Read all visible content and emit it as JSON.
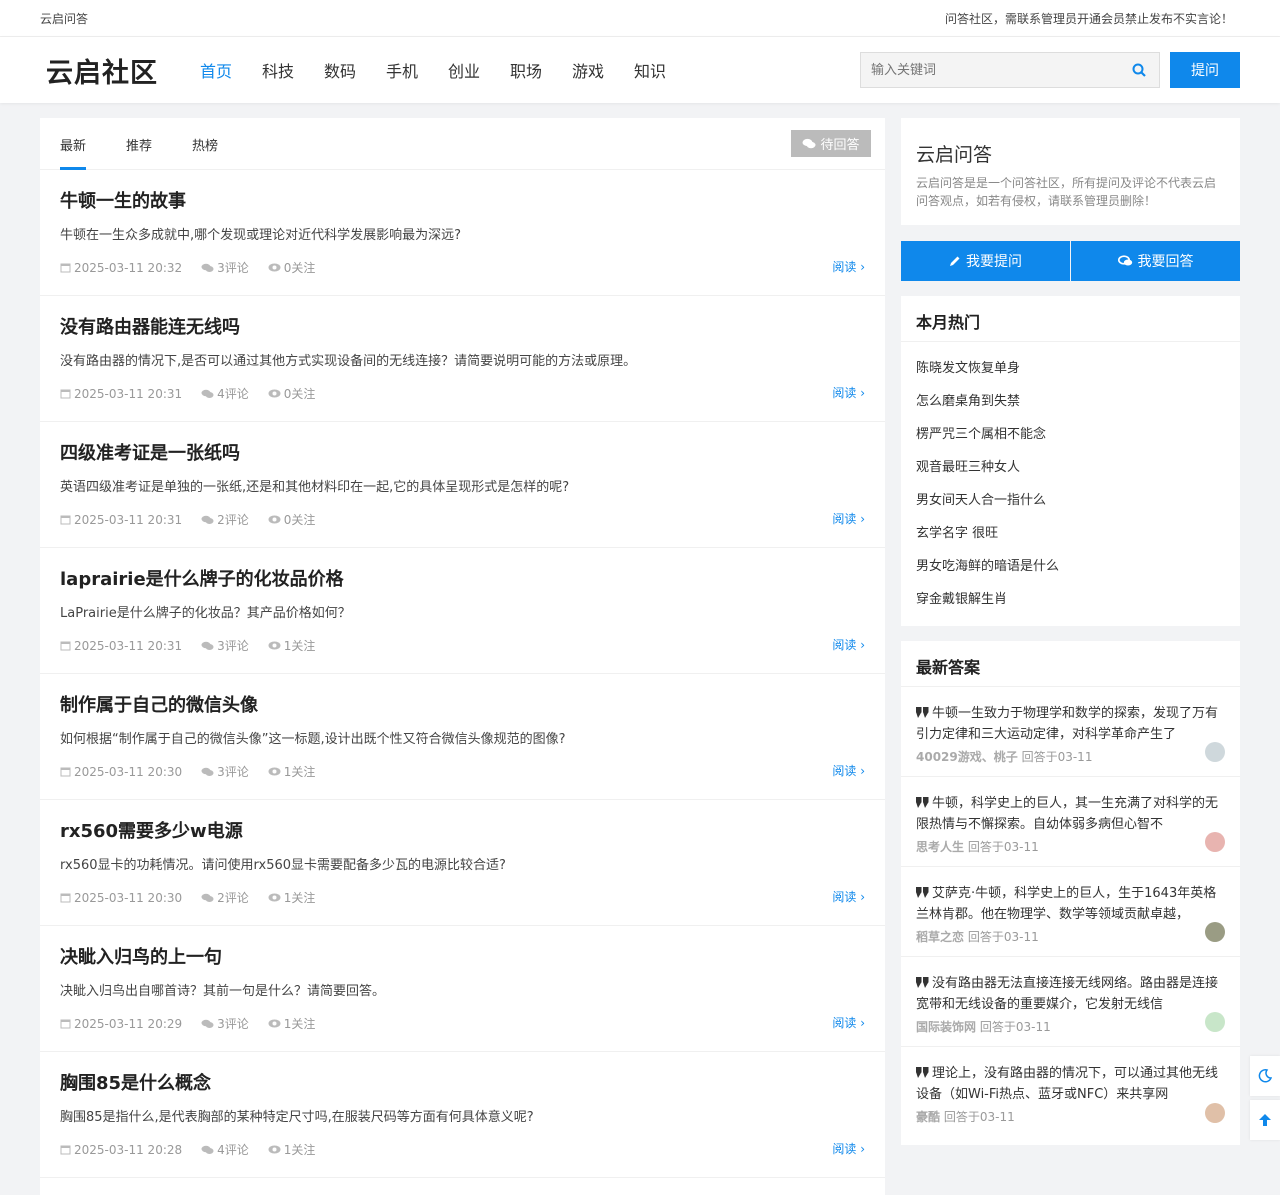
{
  "topbar": {
    "site": "云启问答",
    "notice": "问答社区，需联系管理员开通会员禁止发布不实言论！"
  },
  "header": {
    "logo": "云启社区",
    "nav": [
      "首页",
      "科技",
      "数码",
      "手机",
      "创业",
      "职场",
      "游戏",
      "知识"
    ],
    "search_placeholder": "输入关键词",
    "ask": "提问"
  },
  "tabs": [
    "最新",
    "推荐",
    "热榜"
  ],
  "pending": "待回答",
  "read_label": "阅读",
  "questions": [
    {
      "title": "牛顿一生的故事",
      "desc": "牛顿在一生众多成就中,哪个发现或理论对近代科学发展影响最为深远?",
      "time": "2025-03-11 20:32",
      "comments": "3评论",
      "follows": "0关注"
    },
    {
      "title": "没有路由器能连无线吗",
      "desc": "没有路由器的情况下,是否可以通过其他方式实现设备间的无线连接？请简要说明可能的方法或原理。",
      "time": "2025-03-11 20:31",
      "comments": "4评论",
      "follows": "0关注"
    },
    {
      "title": "四级准考证是一张纸吗",
      "desc": "英语四级准考证是单独的一张纸,还是和其他材料印在一起,它的具体呈现形式是怎样的呢?",
      "time": "2025-03-11 20:31",
      "comments": "2评论",
      "follows": "0关注"
    },
    {
      "title": "laprairie是什么牌子的化妆品价格",
      "desc": "LaPrairie是什么牌子的化妆品？其产品价格如何？",
      "time": "2025-03-11 20:31",
      "comments": "3评论",
      "follows": "1关注"
    },
    {
      "title": "制作属于自己的微信头像",
      "desc": "如何根据“制作属于自己的微信头像”这一标题,设计出既个性又符合微信头像规范的图像?",
      "time": "2025-03-11 20:30",
      "comments": "3评论",
      "follows": "1关注"
    },
    {
      "title": "rx560需要多少w电源",
      "desc": "rx560显卡的功耗情况。请问使用rx560显卡需要配备多少瓦的电源比较合适?",
      "time": "2025-03-11 20:30",
      "comments": "2评论",
      "follows": "1关注"
    },
    {
      "title": "决眦入归鸟的上一句",
      "desc": "决眦入归鸟出自哪首诗？其前一句是什么？请简要回答。",
      "time": "2025-03-11 20:29",
      "comments": "3评论",
      "follows": "1关注"
    },
    {
      "title": "胸围85是什么概念",
      "desc": "胸围85是指什么,是代表胸部的某种特定尺寸吗,在服装尺码等方面有何具体意义呢?",
      "time": "2025-03-11 20:28",
      "comments": "4评论",
      "follows": "1关注"
    }
  ],
  "about": {
    "title": "云启问答",
    "desc": "云启问答是是一个问答社区，所有提问及评论不代表云启问答观点，如若有侵权，请联系管理员删除！"
  },
  "actions": {
    "ask": "我要提问",
    "answer": "我要回答"
  },
  "hot": {
    "title": "本月热门",
    "items": [
      "陈晓发文恢复单身",
      "怎么磨桌角到失禁",
      "楞严咒三个属相不能念",
      "观音最旺三种女人",
      "男女间天人合一指什么",
      "玄学名字 很旺",
      "男女吃海鲜的暗语是什么",
      "穿金戴银解生肖"
    ]
  },
  "answers": {
    "title": "最新答案",
    "items": [
      {
        "text": "牛顿一生致力于物理学和数学的探索，发现了万有引力定律和三大运动定律，对科学革命产生了",
        "user": "40029游戏、桃子",
        "time": "回答于03-11",
        "avatar": "#cfd8dc"
      },
      {
        "text": "牛顿，科学史上的巨人，其一生充满了对科学的无限热情与不懈探索。自幼体弱多病但心智不",
        "user": "思考人生",
        "time": "回答于03-11",
        "avatar": "#e8b4b0"
      },
      {
        "text": "艾萨克·牛顿，科学史上的巨人，生于1643年英格兰林肯郡。他在物理学、数学等领域贡献卓越，",
        "user": "稻草之恋",
        "time": "回答于03-11",
        "avatar": "#9a9c84"
      },
      {
        "text": "没有路由器无法直接连接无线网络。路由器是连接宽带和无线设备的重要媒介，它发射无线信",
        "user": "国际装饰网",
        "time": "回答于03-11",
        "avatar": "#c8e6c9"
      },
      {
        "text": "理论上，没有路由器的情况下，可以通过其他无线设备（如Wi-Fi热点、蓝牙或NFC）来共享网",
        "user": "豪酷",
        "time": "回答于03-11",
        "avatar": "#e0c0a8"
      }
    ]
  }
}
